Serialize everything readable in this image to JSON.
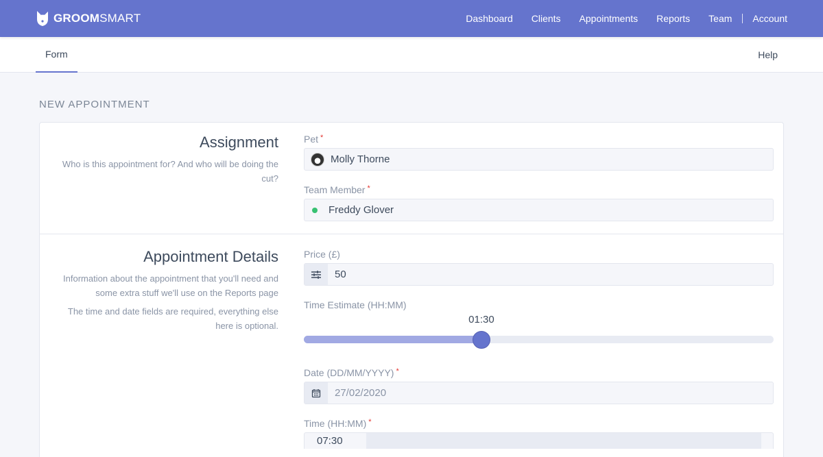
{
  "brand": {
    "name_bold": "GROOM",
    "name_rest": "SMART",
    "logo_icon": "dog-head-icon"
  },
  "nav": {
    "items": [
      "Dashboard",
      "Clients",
      "Appointments",
      "Reports",
      "Team"
    ],
    "account": "Account"
  },
  "subnav": {
    "active_tab": "Form",
    "help": "Help"
  },
  "page": {
    "title": "NEW APPOINTMENT"
  },
  "sections": {
    "assignment": {
      "title": "Assignment",
      "description": "Who is this appointment for? And who will be doing the cut?",
      "pet": {
        "label": "Pet",
        "required": "*",
        "value": "Molly Thorne",
        "avatar_icon": "pet-avatar"
      },
      "team_member": {
        "label": "Team Member",
        "required": "*",
        "value": "Freddy Glover",
        "status_color": "#38c172"
      }
    },
    "details": {
      "title": "Appointment Details",
      "description1": "Information about the appointment that you'll need and some extra stuff we'll use on the Reports page",
      "description2": "The time and date fields are required, everything else here is optional.",
      "price": {
        "label": "Price (£)",
        "value": "50",
        "icon": "sliders-icon"
      },
      "time_estimate": {
        "label": "Time Estimate (HH:MM)",
        "value": "01:30",
        "fraction": 0.378
      },
      "date": {
        "label": "Date (DD/MM/YYYY)",
        "required": "*",
        "value": "27/02/2020",
        "icon": "calendar-icon"
      },
      "time": {
        "label": "Time (HH:MM)",
        "required": "*",
        "value": "07:30"
      }
    }
  },
  "colors": {
    "brand": "#6574cd",
    "required": "#e3342f",
    "slider_fill": "#a1a9e3"
  }
}
